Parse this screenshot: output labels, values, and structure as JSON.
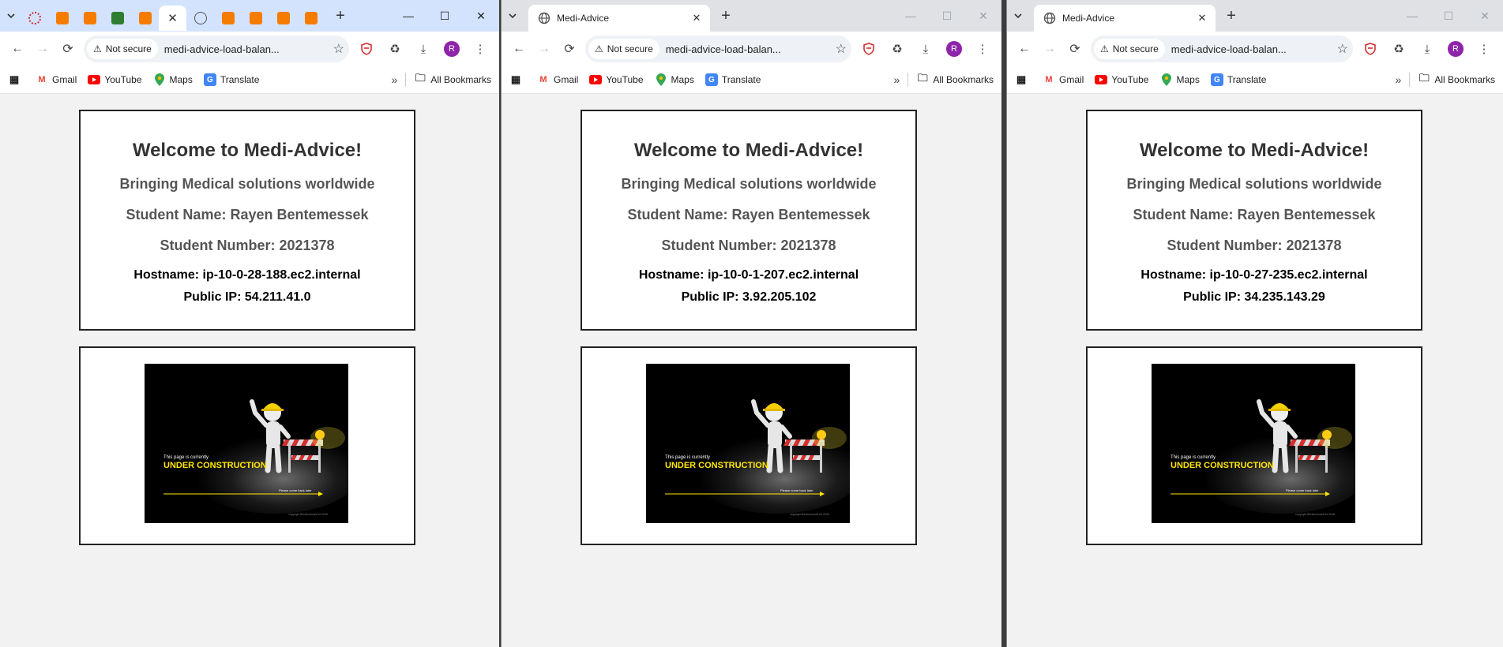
{
  "windows": [
    {
      "tab_title": "",
      "address": {
        "security": "Not secure",
        "url": "medi-advice-load-balan..."
      },
      "page": {
        "welcome": "Welcome to Medi-Advice!",
        "tagline": "Bringing Medical solutions worldwide",
        "student_name": "Student Name: Rayen Bentemessek",
        "student_number": "Student Number: 2021378",
        "hostname": "Hostname: ip-10-0-28-188.ec2.internal",
        "public_ip": "Public IP: 54.211.41.0"
      }
    },
    {
      "tab_title": "Medi-Advice",
      "address": {
        "security": "Not secure",
        "url": "medi-advice-load-balan..."
      },
      "page": {
        "welcome": "Welcome to Medi-Advice!",
        "tagline": "Bringing Medical solutions worldwide",
        "student_name": "Student Name: Rayen Bentemessek",
        "student_number": "Student Number: 2021378",
        "hostname": "Hostname: ip-10-0-1-207.ec2.internal",
        "public_ip": "Public IP: 3.92.205.102"
      }
    },
    {
      "tab_title": "Medi-Advice",
      "address": {
        "security": "Not secure",
        "url": "medi-advice-load-balan..."
      },
      "page": {
        "welcome": "Welcome to Medi-Advice!",
        "tagline": "Bringing Medical solutions worldwide",
        "student_name": "Student Name: Rayen Bentemessek",
        "student_number": "Student Number: 2021378",
        "hostname": "Hostname: ip-10-0-27-235.ec2.internal",
        "public_ip": "Public IP: 34.235.143.29"
      }
    }
  ],
  "bookmarks": [
    "Gmail",
    "YouTube",
    "Maps",
    "Translate"
  ],
  "all_bookmarks": "All Bookmarks",
  "avatar_letter": "R",
  "construction": {
    "line1": "This page is currently",
    "line2": "UNDER CONSTRUCTION",
    "line3": "Please come back later",
    "copyright": "copyright Bentemessek ltd 2008"
  },
  "colors": {
    "tabstrip_active": "#d3e3fd",
    "tabstrip_inactive": "#dfe1e5",
    "avatar": "#8e24aa",
    "construction_text": "#ffe600"
  }
}
